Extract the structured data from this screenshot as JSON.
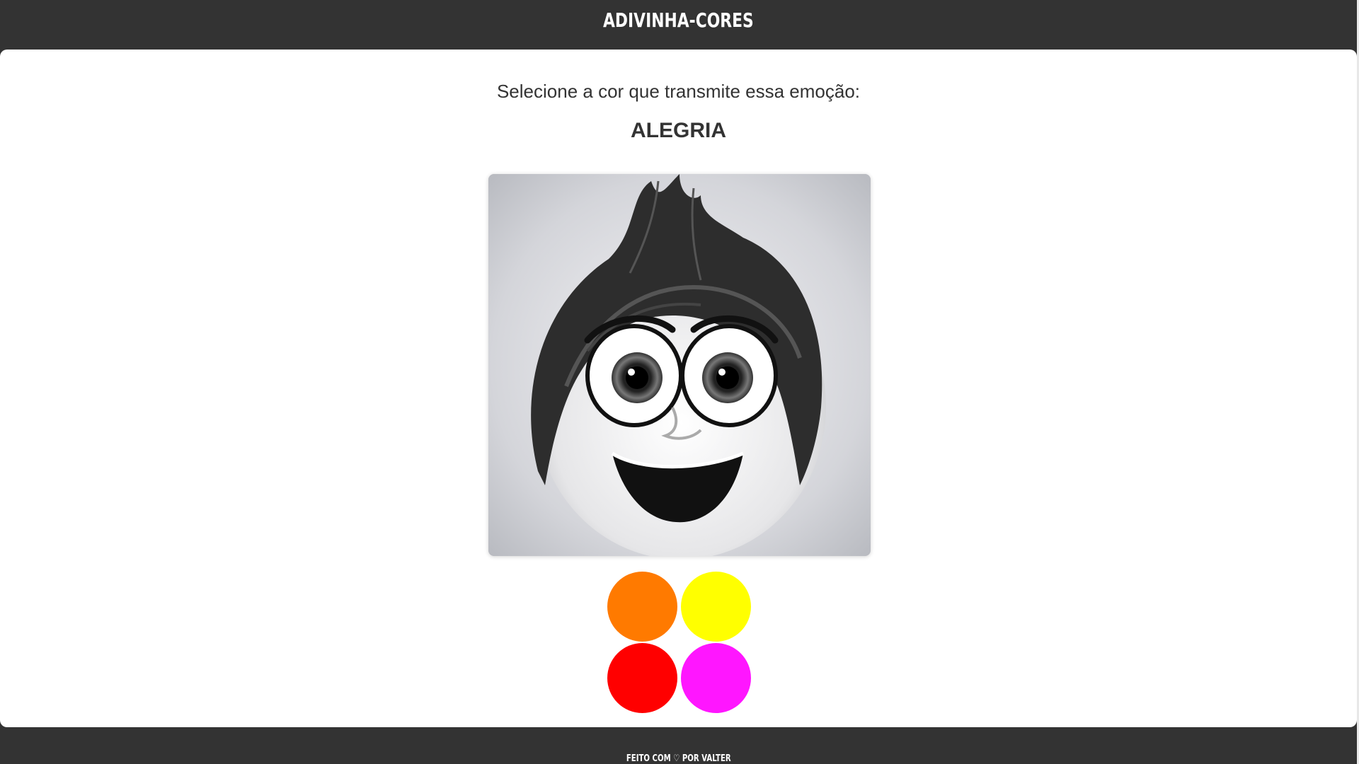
{
  "header": {
    "title": "ADIVINHA-CORES"
  },
  "main": {
    "prompt": "Selecione a cor que transmite essa emoção:",
    "emotion": "ALEGRIA",
    "image_alt": "emotion-face",
    "color_options": [
      {
        "color": "#ff7a00"
      },
      {
        "color": "#ffff00"
      },
      {
        "color": "#ff0000"
      },
      {
        "color": "#ff16ff"
      }
    ]
  },
  "footer": {
    "text": "FEITO COM ♡ POR VALTER"
  },
  "colors": {
    "background": "#333333",
    "card": "#ffffff",
    "text": "#333333"
  }
}
